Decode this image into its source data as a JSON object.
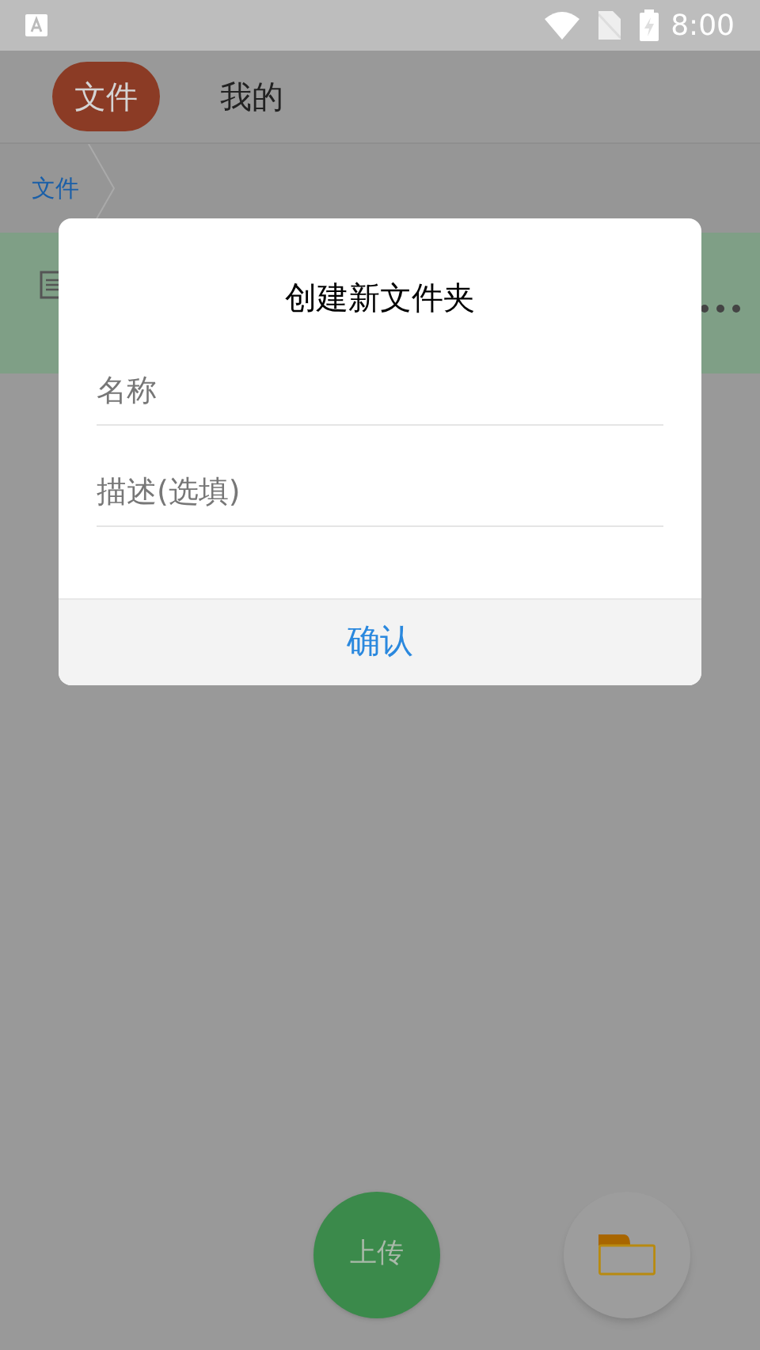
{
  "status_bar": {
    "time": "8:00"
  },
  "tabs": [
    {
      "label": "文件",
      "selected": true
    },
    {
      "label": "我的",
      "selected": false
    }
  ],
  "breadcrumb": [
    {
      "label": "文件"
    }
  ],
  "dialog": {
    "title": "创建新文件夹",
    "fields": [
      {
        "placeholder": "名称"
      },
      {
        "placeholder": "描述(选填)"
      }
    ],
    "confirm": "确认"
  },
  "upload_button": {
    "label": "上传"
  }
}
